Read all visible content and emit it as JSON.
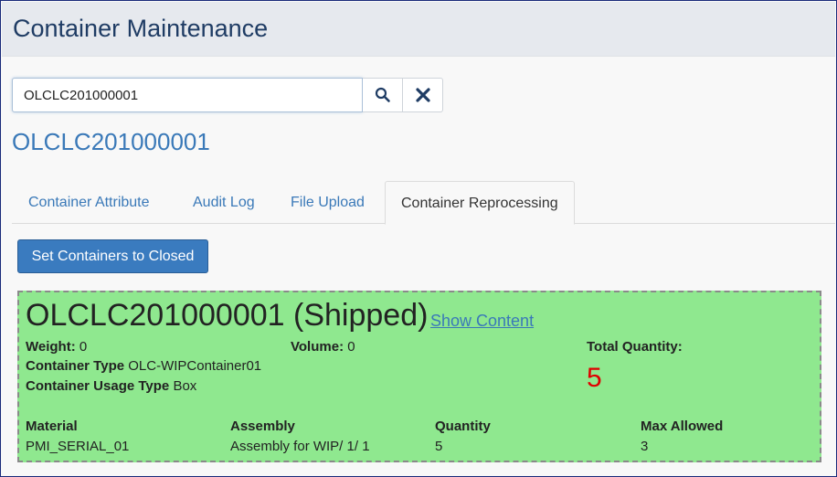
{
  "header": {
    "title": "Container Maintenance"
  },
  "search": {
    "value": "OLCLC201000001"
  },
  "container": {
    "id": "OLCLC201000001"
  },
  "tabs": [
    {
      "label": "Container Attribute"
    },
    {
      "label": "Audit Log"
    },
    {
      "label": "File Upload"
    },
    {
      "label": "Container Reprocessing"
    }
  ],
  "actions": {
    "set_closed_label": "Set Containers to Closed"
  },
  "card": {
    "title": "OLCLC201000001 (Shipped)",
    "show_content": "Show Content",
    "weight_label": "Weight:",
    "weight_value": "0",
    "volume_label": "Volume:",
    "volume_value": "0",
    "total_label": "Total Quantity:",
    "total_value": "5",
    "type_label": "Container Type",
    "type_value": "OLC-WIPContainer01",
    "usage_label": "Container Usage Type",
    "usage_value": "Box",
    "columns": [
      "Material",
      "Assembly",
      "Quantity",
      "Max Allowed"
    ],
    "row": [
      "PMI_SERIAL_01",
      "Assembly for WIP/ 1/ 1",
      "5",
      "3"
    ]
  },
  "colors": {
    "card_bg": "#8fe88f",
    "accent": "#3a7bbf",
    "total": "#e00000"
  },
  "icons": [
    "search-icon",
    "close-icon"
  ]
}
